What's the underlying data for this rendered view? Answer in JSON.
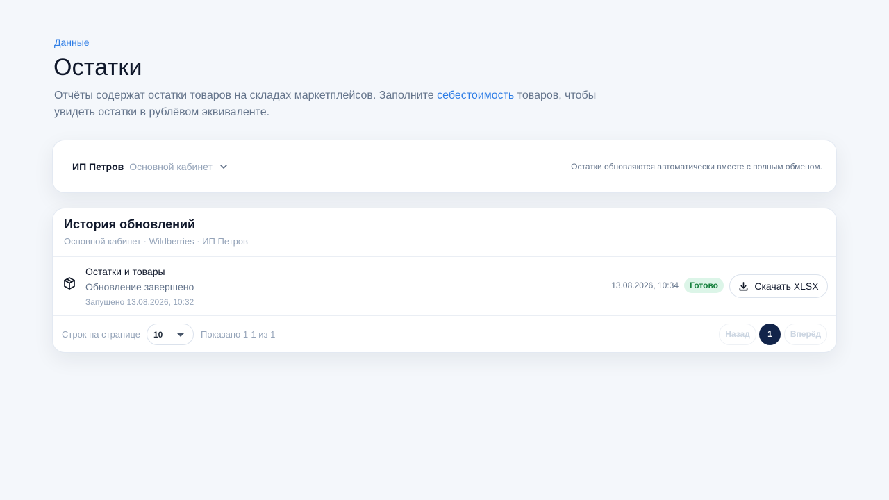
{
  "breadcrumb": "Данные",
  "title": "Остатки",
  "description": {
    "before": "Отчёты содержат остатки товаров на складах маркетплейсов. Заполните ",
    "link": "себестоимость",
    "after": " товаров, чтобы увидеть остатки в рублёвом эквиваленте."
  },
  "account": {
    "name": "ИП Петров",
    "cabinet": "Основной кабинет",
    "note": "Остатки обновляются автоматически вместе с полным обменом."
  },
  "history": {
    "title": "История обновлений",
    "subtitle": "Основной кабинет · Wildberries · ИП Петров",
    "rows": [
      {
        "title": "Остатки и товары",
        "status": "Обновление завершено",
        "started": "Запущено 13.08.2026, 10:32",
        "finished": "13.08.2026, 10:34",
        "badge": "Готово",
        "download_label": "Скачать XLSX",
        "icon": "box-icon"
      }
    ]
  },
  "pagination": {
    "rows_label": "Строк на странице",
    "rows_per_page": "10",
    "shown": "Показано 1-1 из 1",
    "prev": "Назад",
    "page": "1",
    "next": "Вперёд"
  },
  "colors": {
    "accent": "#2f7ee6",
    "badge_bg": "#dcf5e8",
    "badge_text": "#15803d",
    "active_page": "#12244a"
  }
}
